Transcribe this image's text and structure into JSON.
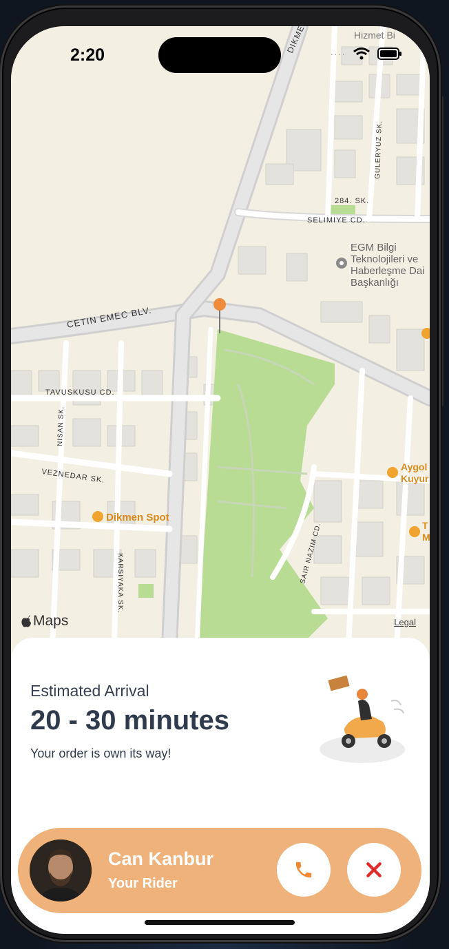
{
  "status": {
    "time": "2:20"
  },
  "map": {
    "logo": "Maps",
    "legal": "Legal",
    "labels": {
      "cetin": "CETIN EMEC BLV.",
      "tavuskusu": "TAVUSKUSU CD.",
      "veznedar": "VEZNEDAR SK.",
      "nisan": "NISAN SK.",
      "karsiyaka": "KARSIYAKA SK.",
      "sair": "SAIR NAZIM CD.",
      "guleryuz": "GULERYUZ SK.",
      "sok284": "284. SK.",
      "selimiye": "SELIMIYE CD.",
      "dikmen_top": "DIKMEN",
      "hizmet": "Hizmet Bi",
      "egm1": "EGM Bilgi",
      "egm2": "Teknolojileri ve",
      "egm3": "Haberleşme Dai",
      "egm4": "Başkanlığı",
      "dikmen_spot": "Dikmen Spot",
      "aygol1": "Aygol",
      "aygol2": "Kuyur",
      "t1": "T",
      "t2": "M"
    }
  },
  "sheet": {
    "est_label": "Estimated Arrival",
    "est_time": "20 - 30 minutes",
    "subtitle": "Your order is own its way!"
  },
  "rider": {
    "name": "Can Kanbur",
    "role": "Your Rider"
  },
  "colors": {
    "accent": "#efb27a",
    "call_icon": "#ef8a34",
    "cancel_icon": "#e02b2b",
    "park": "#b8dc94",
    "pin": "#f08a3c"
  },
  "icons": {
    "call": "phone-icon",
    "cancel": "close-icon",
    "status": [
      "cellular-icon",
      "wifi-icon",
      "battery-icon"
    ]
  }
}
